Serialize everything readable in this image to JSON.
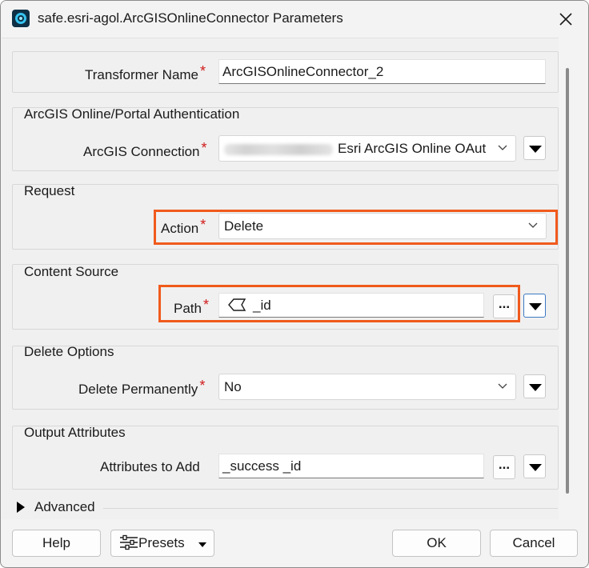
{
  "window": {
    "title": "safe.esri-agol.ArcGISOnlineConnector Parameters"
  },
  "transformer": {
    "label": "Transformer Name",
    "value": "ArcGISOnlineConnector_2"
  },
  "auth": {
    "group_title": "ArcGIS Online/Portal Authentication",
    "label": "ArcGIS Connection",
    "value": "Esri ArcGIS Online OAut"
  },
  "request": {
    "group_title": "Request",
    "label": "Action",
    "value": "Delete"
  },
  "content_source": {
    "group_title": "Content Source",
    "label": "Path",
    "value": "_id",
    "ellipsis": "..."
  },
  "delete_options": {
    "group_title": "Delete Options",
    "label": "Delete Permanently",
    "value": "No"
  },
  "output": {
    "group_title": "Output Attributes",
    "label": "Attributes to Add",
    "value": "_success _id",
    "ellipsis": "..."
  },
  "advanced": {
    "label": "Advanced"
  },
  "footer": {
    "help": "Help",
    "presets": "Presets",
    "ok": "OK",
    "cancel": "Cancel"
  },
  "required_marker": "*",
  "colors": {
    "highlight": "#f05a1c",
    "required": "#d11a1a"
  }
}
